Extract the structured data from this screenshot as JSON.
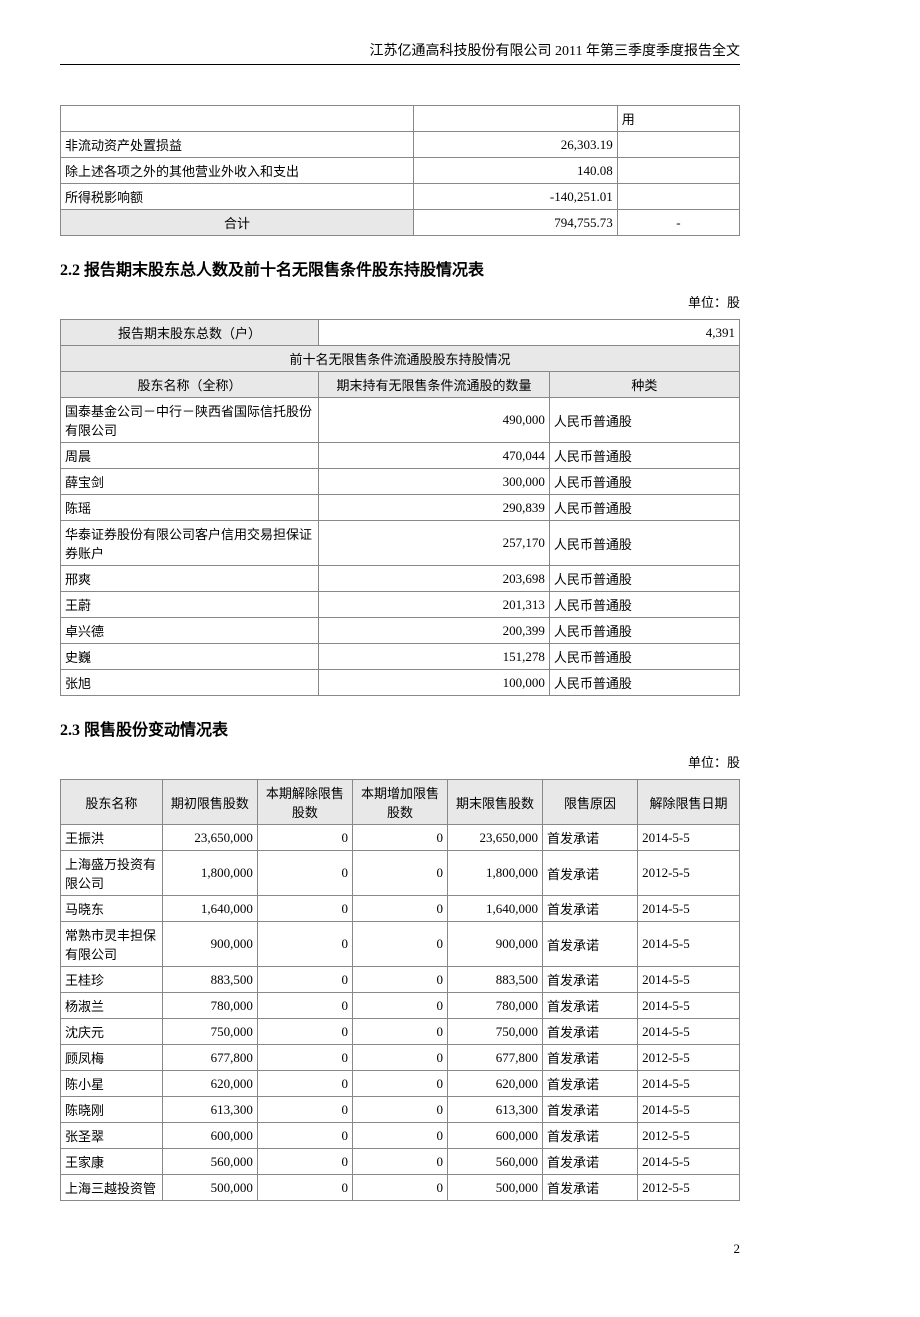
{
  "header": "江苏亿通高科技股份有限公司 2011 年第三季度季度报告全文",
  "page_num": "2",
  "table1": {
    "head_last": "用",
    "rows": [
      {
        "item": "非流动资产处置损益",
        "amount": "26,303.19",
        "note": ""
      },
      {
        "item": "除上述各项之外的其他营业外收入和支出",
        "amount": "140.08",
        "note": ""
      },
      {
        "item": "所得税影响额",
        "amount": "-140,251.01",
        "note": ""
      }
    ],
    "total_label": "合计",
    "total_amount": "794,755.73",
    "total_note": "-"
  },
  "section22_title": "2.2 报告期末股东总人数及前十名无限售条件股东持股情况表",
  "section22_unit": "单位：股",
  "table2": {
    "header_total_label": "报告期末股东总数（户）",
    "header_total_value": "4,391",
    "subheader": "前十名无限售条件流通股股东持股情况",
    "col1": "股东名称（全称）",
    "col2": "期末持有无限售条件流通股的数量",
    "col3": "种类",
    "rows": [
      {
        "name": "国泰基金公司－中行－陕西省国际信托股份有限公司",
        "shares": "490,000",
        "type": "人民币普通股"
      },
      {
        "name": "周晨",
        "shares": "470,044",
        "type": "人民币普通股"
      },
      {
        "name": "薛宝剑",
        "shares": "300,000",
        "type": "人民币普通股"
      },
      {
        "name": "陈瑶",
        "shares": "290,839",
        "type": "人民币普通股"
      },
      {
        "name": "华泰证券股份有限公司客户信用交易担保证券账户",
        "shares": "257,170",
        "type": "人民币普通股"
      },
      {
        "name": "邢爽",
        "shares": "203,698",
        "type": "人民币普通股"
      },
      {
        "name": "王蔚",
        "shares": "201,313",
        "type": "人民币普通股"
      },
      {
        "name": "卓兴德",
        "shares": "200,399",
        "type": "人民币普通股"
      },
      {
        "name": "史巍",
        "shares": "151,278",
        "type": "人民币普通股"
      },
      {
        "name": "张旭",
        "shares": "100,000",
        "type": "人民币普通股"
      }
    ]
  },
  "section23_title": "2.3 限售股份变动情况表",
  "section23_unit": "单位：股",
  "table3": {
    "col1": "股东名称",
    "col2": "期初限售股数",
    "col3": "本期解除限售股数",
    "col4": "本期增加限售股数",
    "col5": "期末限售股数",
    "col6": "限售原因",
    "col7": "解除限售日期",
    "rows": [
      {
        "name": "王振洪",
        "init": "23,650,000",
        "rel": "0",
        "add": "0",
        "end": "23,650,000",
        "reason": "首发承诺",
        "date": "2014-5-5"
      },
      {
        "name": "上海盛万投资有限公司",
        "init": "1,800,000",
        "rel": "0",
        "add": "0",
        "end": "1,800,000",
        "reason": "首发承诺",
        "date": "2012-5-5"
      },
      {
        "name": "马晓东",
        "init": "1,640,000",
        "rel": "0",
        "add": "0",
        "end": "1,640,000",
        "reason": "首发承诺",
        "date": "2014-5-5"
      },
      {
        "name": "常熟市灵丰担保有限公司",
        "init": "900,000",
        "rel": "0",
        "add": "0",
        "end": "900,000",
        "reason": "首发承诺",
        "date": "2014-5-5"
      },
      {
        "name": "王桂珍",
        "init": "883,500",
        "rel": "0",
        "add": "0",
        "end": "883,500",
        "reason": "首发承诺",
        "date": "2014-5-5"
      },
      {
        "name": "杨淑兰",
        "init": "780,000",
        "rel": "0",
        "add": "0",
        "end": "780,000",
        "reason": "首发承诺",
        "date": "2014-5-5"
      },
      {
        "name": "沈庆元",
        "init": "750,000",
        "rel": "0",
        "add": "0",
        "end": "750,000",
        "reason": "首发承诺",
        "date": "2014-5-5"
      },
      {
        "name": "顾凤梅",
        "init": "677,800",
        "rel": "0",
        "add": "0",
        "end": "677,800",
        "reason": "首发承诺",
        "date": "2012-5-5"
      },
      {
        "name": "陈小星",
        "init": "620,000",
        "rel": "0",
        "add": "0",
        "end": "620,000",
        "reason": "首发承诺",
        "date": "2014-5-5"
      },
      {
        "name": "陈晓刚",
        "init": "613,300",
        "rel": "0",
        "add": "0",
        "end": "613,300",
        "reason": "首发承诺",
        "date": "2014-5-5"
      },
      {
        "name": "张圣翠",
        "init": "600,000",
        "rel": "0",
        "add": "0",
        "end": "600,000",
        "reason": "首发承诺",
        "date": "2012-5-5"
      },
      {
        "name": "王家康",
        "init": "560,000",
        "rel": "0",
        "add": "0",
        "end": "560,000",
        "reason": "首发承诺",
        "date": "2014-5-5"
      },
      {
        "name": "上海三越投资管",
        "init": "500,000",
        "rel": "0",
        "add": "0",
        "end": "500,000",
        "reason": "首发承诺",
        "date": "2012-5-5"
      }
    ]
  }
}
